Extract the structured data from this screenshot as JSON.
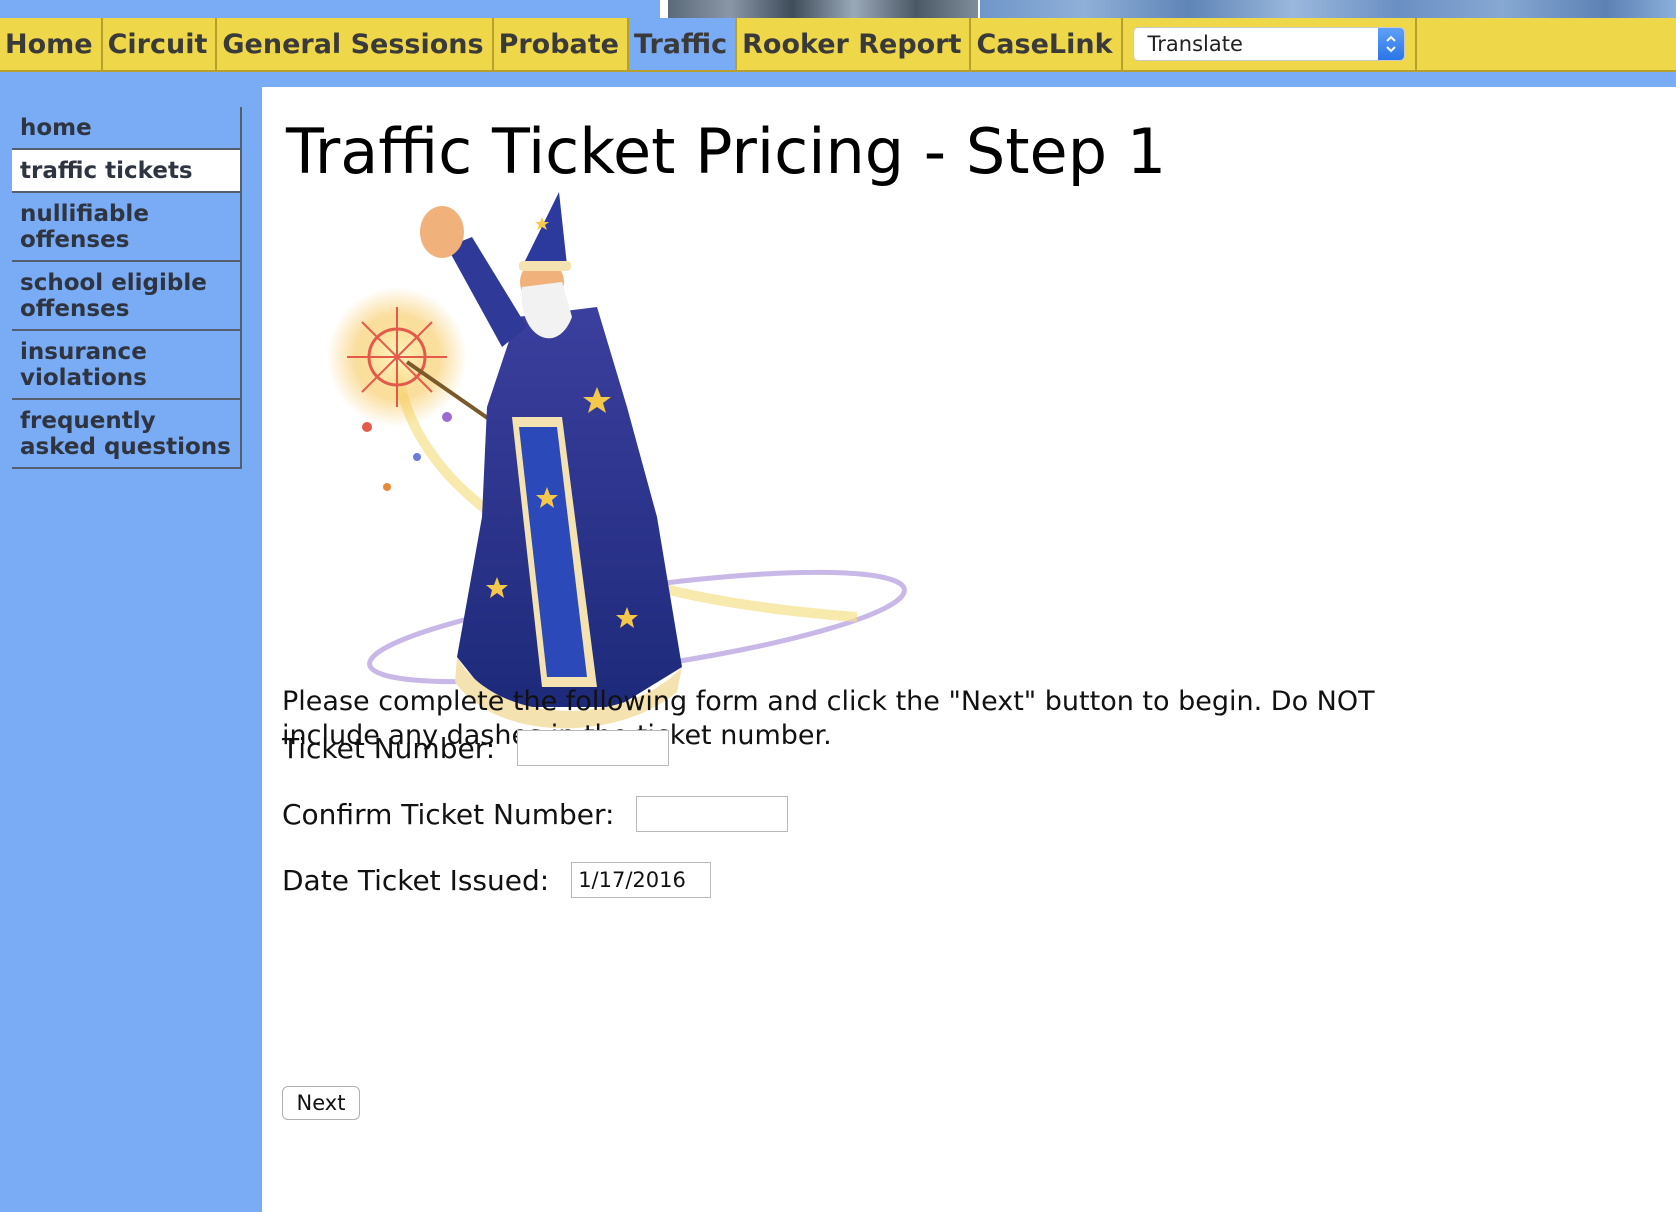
{
  "top_nav": {
    "items": [
      {
        "label": "Home"
      },
      {
        "label": "Circuit"
      },
      {
        "label": "General Sessions"
      },
      {
        "label": "Probate"
      },
      {
        "label": "Traffic",
        "active": true
      },
      {
        "label": "Rooker Report"
      },
      {
        "label": "CaseLink"
      }
    ],
    "translate_label": "Translate"
  },
  "sidebar": {
    "items": [
      {
        "label": "home"
      },
      {
        "label": "traffic tickets",
        "active": true
      },
      {
        "label": "nullifiable offenses"
      },
      {
        "label": "school eligible offenses"
      },
      {
        "label": "insurance violations"
      },
      {
        "label": "frequently asked questions"
      }
    ]
  },
  "main": {
    "title": "Traffic Ticket Pricing - Step 1",
    "instructions": "Please complete the following form and click the \"Next\" button to begin. Do NOT include any dashes in the ticket number.",
    "form": {
      "ticket_number_label": "Ticket Number:",
      "ticket_number_value": "",
      "confirm_ticket_label": "Confirm Ticket Number:",
      "confirm_ticket_value": "",
      "date_issued_label": "Date Ticket Issued:",
      "date_issued_value": "1/17/2016"
    },
    "next_label": "Next"
  },
  "colors": {
    "page_background": "#7aabf5",
    "nav_background": "#eed84a",
    "nav_active": "#7aabf5",
    "content_background": "#ffffff"
  }
}
